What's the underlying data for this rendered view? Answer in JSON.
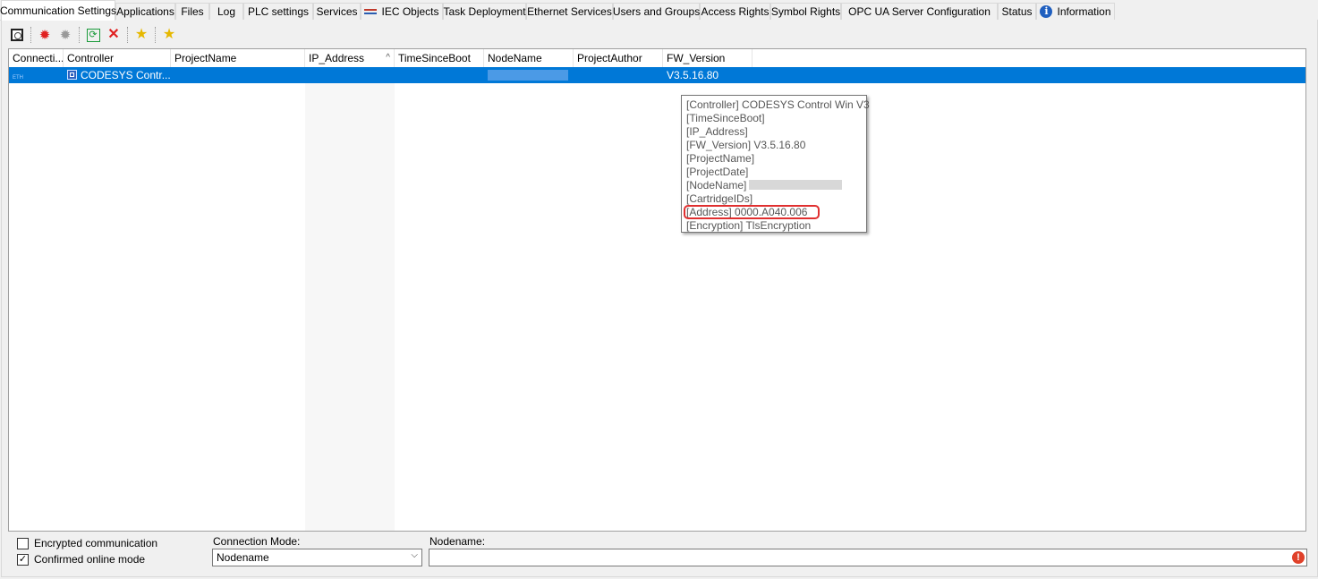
{
  "tabs": [
    {
      "label": "Communication Settings",
      "active": true
    },
    {
      "label": "Applications"
    },
    {
      "label": "Files"
    },
    {
      "label": "Log"
    },
    {
      "label": "PLC settings"
    },
    {
      "label": "Services"
    },
    {
      "label": "IEC Objects",
      "icon": "iec-objects-icon"
    },
    {
      "label": "Task Deployment"
    },
    {
      "label": "Ethernet Services"
    },
    {
      "label": "Users and Groups"
    },
    {
      "label": "Access Rights"
    },
    {
      "label": "Symbol Rights"
    },
    {
      "label": "OPC UA Server Configuration"
    },
    {
      "label": "Status"
    },
    {
      "label": "Information",
      "icon": "info-icon"
    }
  ],
  "toolbar": {
    "buttons": [
      "select-gateway-icon",
      "scan-network-icon",
      "scan-disabled-icon",
      "refresh-icon",
      "delete-icon",
      "add-favorite-icon",
      "favorites-icon"
    ],
    "icons": {
      "select-gateway-icon": "",
      "refresh": "⟳",
      "delete": "✕",
      "star": "★",
      "scan": "✹"
    }
  },
  "grid": {
    "columns": [
      "Connecti...",
      "Controller",
      "ProjectName",
      "IP_Address",
      "TimeSinceBoot",
      "NodeName",
      "ProjectAuthor",
      "FW_Version"
    ],
    "sort_indicator": "^",
    "rows": [
      {
        "connection": "ETH",
        "controller": "CODESYS Contr...",
        "project_name": "",
        "ip_address": "",
        "time_since_boot": "",
        "node_name": "",
        "project_author": "",
        "fw_version": "V3.5.16.80",
        "selected": true
      }
    ]
  },
  "tooltip": {
    "lines": [
      "[Controller] CODESYS Control Win V3",
      "[TimeSinceBoot]",
      "[IP_Address]",
      "[FW_Version] V3.5.16.80",
      "[ProjectName]",
      "[ProjectDate]",
      "[NodeName]",
      "[CartridgeIDs]",
      "[Address] 0000.A040.006",
      "[Encryption] TlsEncryption"
    ]
  },
  "bottom": {
    "encrypted_label": "Encrypted communication",
    "encrypted_checked": false,
    "confirmed_label": "Confirmed online mode",
    "confirmed_checked": true,
    "check_mark": "✓",
    "connection_mode_label": "Connection Mode:",
    "connection_mode_value": "Nodename",
    "nodename_label": "Nodename:",
    "nodename_value": "",
    "dropdown_arrow": "⌵",
    "error_mark": "!"
  },
  "colors": {
    "selection": "#0078d7",
    "highlight": "#e03030",
    "error": "#e0412a"
  }
}
